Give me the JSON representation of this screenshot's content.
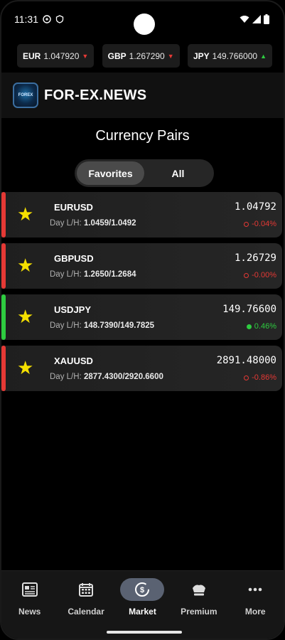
{
  "status_bar": {
    "time": "11:31"
  },
  "ticker": [
    {
      "symbol": "EUR",
      "value": "1.047920",
      "direction": "down"
    },
    {
      "symbol": "GBP",
      "value": "1.267290",
      "direction": "down"
    },
    {
      "symbol": "JPY",
      "value": "149.766000",
      "direction": "up"
    }
  ],
  "header": {
    "logo_text": "FOREX",
    "brand": "FOR-EX.NEWS"
  },
  "page": {
    "title": "Currency Pairs"
  },
  "tabs": [
    {
      "label": "Favorites",
      "active": true
    },
    {
      "label": "All",
      "active": false
    }
  ],
  "pairs": [
    {
      "symbol": "EURUSD",
      "range_label": "Day L/H:",
      "range": "1.0459/1.0492",
      "price": "1.04792",
      "change": "-0.04%",
      "trend": "neg"
    },
    {
      "symbol": "GBPUSD",
      "range_label": "Day L/H:",
      "range": "1.2650/1.2684",
      "price": "1.26729",
      "change": "-0.00%",
      "trend": "neg"
    },
    {
      "symbol": "USDJPY",
      "range_label": "Day L/H:",
      "range": "148.7390/149.7825",
      "price": "149.76600",
      "change": "0.46%",
      "trend": "pos"
    },
    {
      "symbol": "XAUUSD",
      "range_label": "Day L/H:",
      "range": "2877.4300/2920.6600",
      "price": "2891.48000",
      "change": "-0.86%",
      "trend": "neg"
    }
  ],
  "colors": {
    "negative": "#e53935",
    "positive": "#2ecc40",
    "star": "#f5e000"
  },
  "nav": [
    {
      "label": "News",
      "icon": "news-icon"
    },
    {
      "label": "Calendar",
      "icon": "calendar-icon"
    },
    {
      "label": "Market",
      "icon": "market-icon",
      "active": true
    },
    {
      "label": "Premium",
      "icon": "crown-icon"
    },
    {
      "label": "More",
      "icon": "more-icon"
    }
  ]
}
